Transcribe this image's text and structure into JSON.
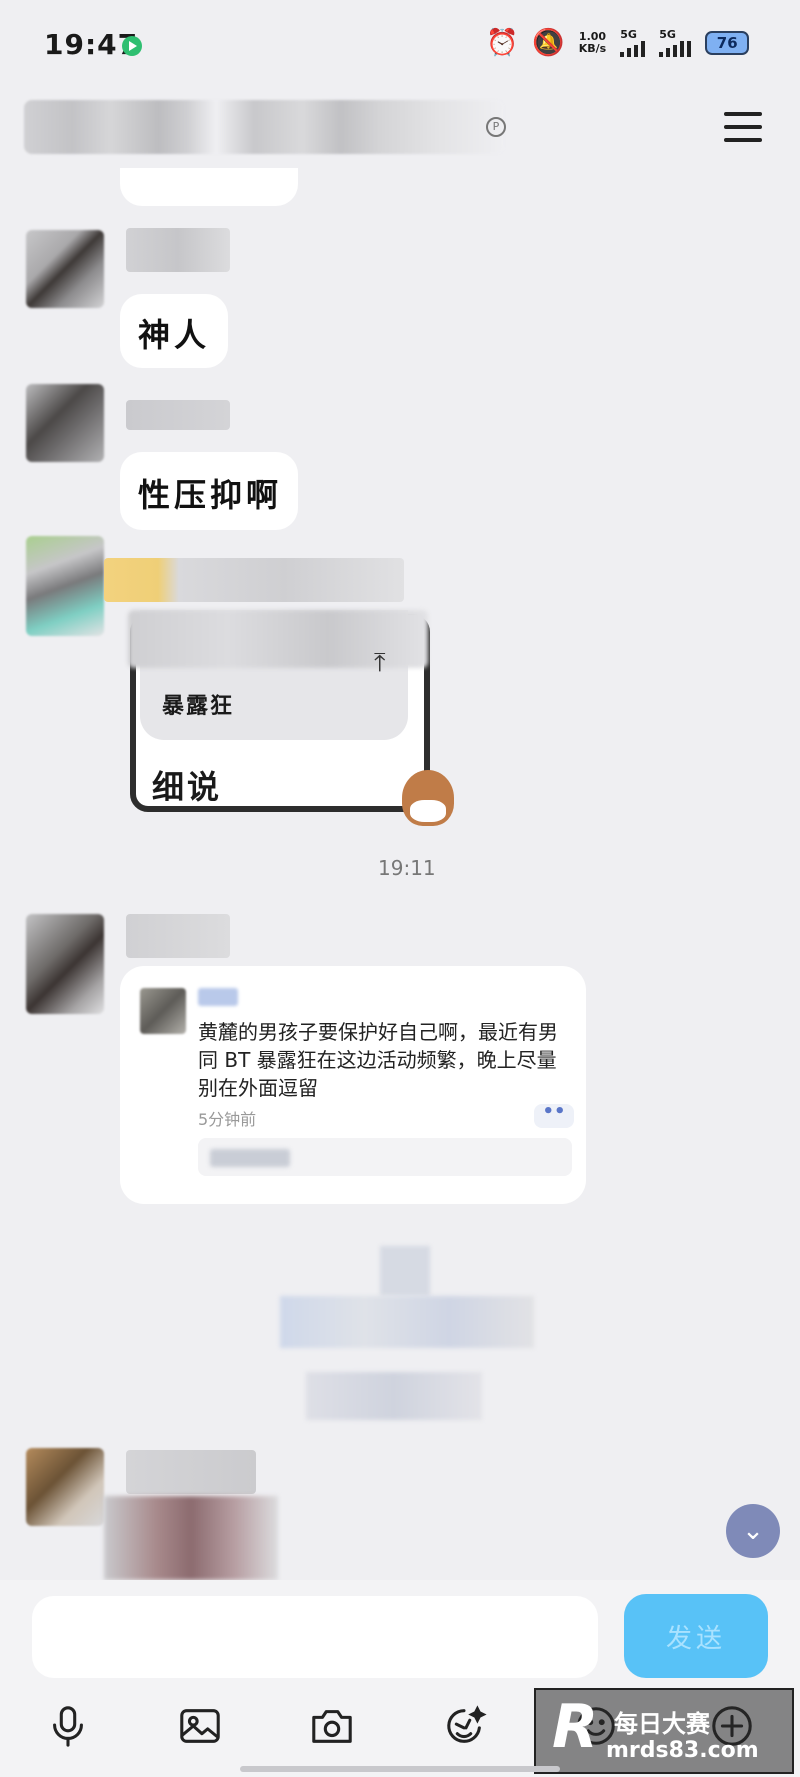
{
  "status_bar": {
    "time": "19:47",
    "net_speed_value": "1.00",
    "net_speed_unit": "KB/s",
    "sim1_label": "5G",
    "sim2_label": "5G",
    "battery": "76"
  },
  "header": {
    "title_hidden": true,
    "menu_icon": "menu-icon"
  },
  "messages": {
    "msg1": "神人",
    "msg2": "性压抑啊",
    "sticker_quote": "暴露狂",
    "sticker_text": "细说",
    "time_divider": "19:11"
  },
  "shared_card": {
    "text": "黄麓的男孩子要保护好自己啊，最近有男同 BT 暴露狂在这边活动频繁，晚上尽量别在外面逗留",
    "time": "5分钟前",
    "more_label": "••"
  },
  "input_bar": {
    "placeholder": "",
    "send_label": "发送",
    "tools": [
      "mic-icon",
      "image-icon",
      "camera-icon",
      "sticker-icon",
      "emoji-icon",
      "plus-icon"
    ]
  },
  "watermark": {
    "logo": "R",
    "cn": "每日大赛",
    "url": "mrds83.com"
  },
  "colors": {
    "background": "#efeff2",
    "send_button": "#58c2f7",
    "bubble": "#ffffff",
    "scroll_button": "#7f8ab8"
  }
}
